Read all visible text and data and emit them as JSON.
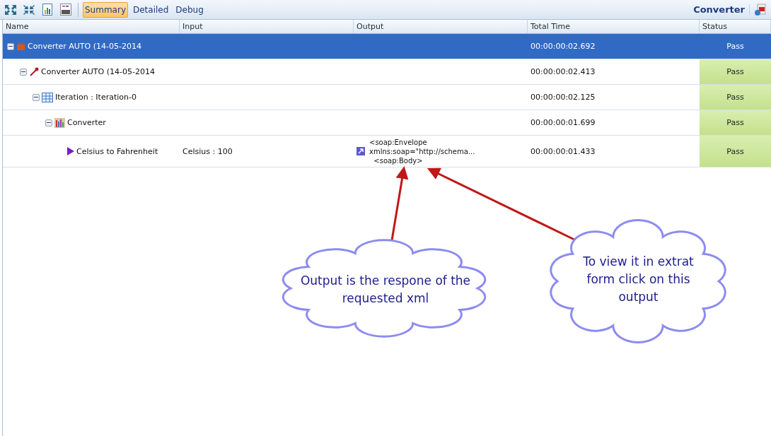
{
  "toolbar": {
    "views": [
      {
        "label": "Summary",
        "selected": true
      },
      {
        "label": "Detailed",
        "selected": false
      },
      {
        "label": "Debug",
        "selected": false
      }
    ],
    "title": "Converter"
  },
  "table": {
    "columns": [
      "Name",
      "Input",
      "Output",
      "Total Time",
      "Status"
    ],
    "rows": [
      {
        "kind": "suite",
        "name": "Converter AUTO (14-05-2014",
        "selected": true,
        "expanded": true,
        "total_time": "00:00:00:02.692",
        "status": "Pass",
        "children": [
          {
            "kind": "test",
            "name": "Converter AUTO (14-05-2014",
            "selected": false,
            "expanded": true,
            "total_time": "00:00:00:02.413",
            "status": "Pass",
            "children": [
              {
                "kind": "iteration",
                "name": "Iteration : Iteration-0",
                "selected": false,
                "expanded": true,
                "total_time": "00:00:00:02.125",
                "status": "Pass",
                "children": [
                  {
                    "kind": "service",
                    "name": "Converter",
                    "selected": false,
                    "expanded": true,
                    "total_time": "00:00:00:01.699",
                    "status": "Pass",
                    "children": [
                      {
                        "kind": "step",
                        "name": "Celsius to Fahrenheit",
                        "selected": false,
                        "input": "Celsius : 100",
                        "output": [
                          "<soap:Envelope",
                          "xmlns:soap=\"http://schema...",
                          "  <soap:Body>"
                        ],
                        "total_time": "00:00:00:01.433",
                        "status": "Pass"
                      }
                    ]
                  }
                ]
              }
            ]
          }
        ]
      }
    ]
  },
  "callouts": [
    {
      "text": "Output is the respone of the requested xml"
    },
    {
      "text": "To view it in extrat form click on this output"
    }
  ]
}
